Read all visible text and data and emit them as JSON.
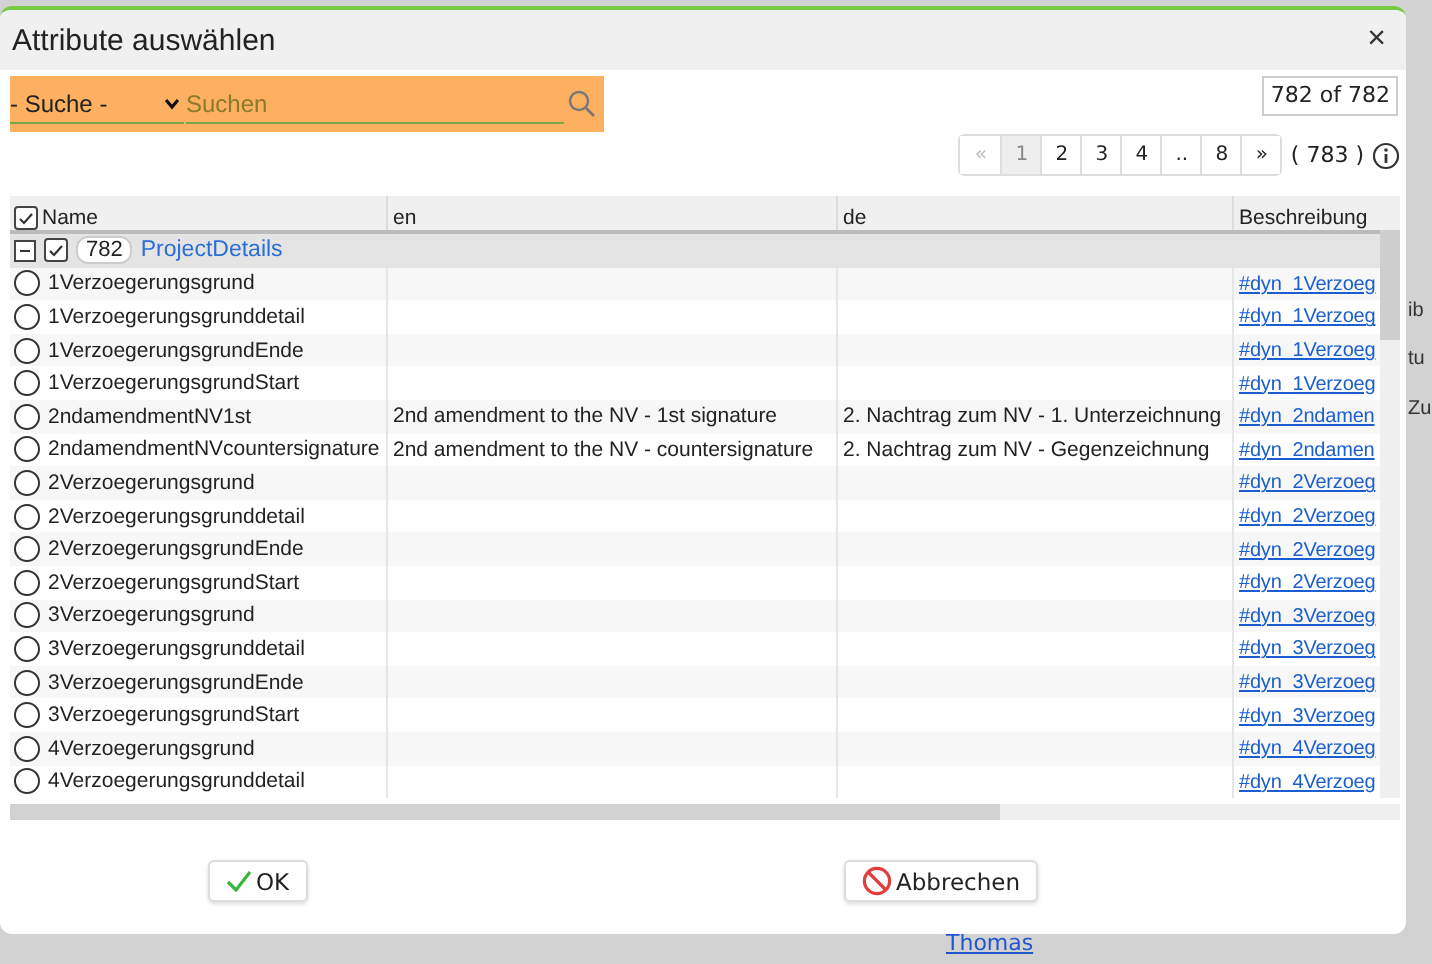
{
  "dialog": {
    "title": "Attribute auswählen",
    "close": "×"
  },
  "search": {
    "scope": "- Suche -",
    "placeholder": "Suchen"
  },
  "count": "782 of 782",
  "pagination": {
    "pages": [
      {
        "label": "«",
        "disabled": true,
        "selected": false
      },
      {
        "label": "1",
        "disabled": false,
        "selected": true
      },
      {
        "label": "2",
        "disabled": false,
        "selected": false
      },
      {
        "label": "3",
        "disabled": false,
        "selected": false
      },
      {
        "label": "4",
        "disabled": false,
        "selected": false
      },
      {
        "label": "..",
        "disabled": false,
        "selected": false
      },
      {
        "label": "8",
        "disabled": false,
        "selected": false
      },
      {
        "label": "»",
        "disabled": false,
        "selected": false
      }
    ],
    "total": "( 783 )"
  },
  "table": {
    "columns": [
      "Name",
      "en",
      "de",
      "Beschreibung"
    ],
    "all_checked": true,
    "group": {
      "expanded": true,
      "checked": true,
      "count": "782",
      "name": "ProjectDetails"
    },
    "rows": [
      {
        "name": "1Verzoegerungsgrund",
        "en": "",
        "de": "",
        "desc": "#dyn_1Verzoeg",
        "selected": false
      },
      {
        "name": "1Verzoegerungsgrunddetail",
        "en": "",
        "de": "",
        "desc": "#dyn_1Verzoeg",
        "selected": false
      },
      {
        "name": "1VerzoegerungsgrundEnde",
        "en": "",
        "de": "",
        "desc": "#dyn_1Verzoeg",
        "selected": false
      },
      {
        "name": "1VerzoegerungsgrundStart",
        "en": "",
        "de": "",
        "desc": "#dyn_1Verzoeg",
        "selected": false
      },
      {
        "name": "2ndamendmentNV1st",
        "en": "2nd amendment to the NV - 1st signature",
        "de": "2. Nachtrag zum NV - 1. Unterzeichnung",
        "desc": "#dyn_2ndamen",
        "selected": false
      },
      {
        "name": "2ndamendmentNVcountersignature",
        "en": "2nd amendment to the NV - countersignature",
        "de": "2. Nachtrag zum NV - Gegenzeichnung",
        "desc": "#dyn_2ndamen",
        "selected": false
      },
      {
        "name": "2Verzoegerungsgrund",
        "en": "",
        "de": "",
        "desc": "#dyn_2Verzoeg",
        "selected": false
      },
      {
        "name": "2Verzoegerungsgrunddetail",
        "en": "",
        "de": "",
        "desc": "#dyn_2Verzoeg",
        "selected": false
      },
      {
        "name": "2VerzoegerungsgrundEnde",
        "en": "",
        "de": "",
        "desc": "#dyn_2Verzoeg",
        "selected": false
      },
      {
        "name": "2VerzoegerungsgrundStart",
        "en": "",
        "de": "",
        "desc": "#dyn_2Verzoeg",
        "selected": false
      },
      {
        "name": "3Verzoegerungsgrund",
        "en": "",
        "de": "",
        "desc": "#dyn_3Verzoeg",
        "selected": false
      },
      {
        "name": "3Verzoegerungsgrunddetail",
        "en": "",
        "de": "",
        "desc": "#dyn_3Verzoeg",
        "selected": false
      },
      {
        "name": "3VerzoegerungsgrundEnde",
        "en": "",
        "de": "",
        "desc": "#dyn_3Verzoeg",
        "selected": false
      },
      {
        "name": "3VerzoegerungsgrundStart",
        "en": "",
        "de": "",
        "desc": "#dyn_3Verzoeg",
        "selected": false
      },
      {
        "name": "4Verzoegerungsgrund",
        "en": "",
        "de": "",
        "desc": "#dyn_4Verzoeg",
        "selected": false
      },
      {
        "name": "4Verzoegerungsgrunddetail",
        "en": "",
        "de": "",
        "desc": "#dyn_4Verzoeg",
        "selected": false
      }
    ]
  },
  "buttons": [
    {
      "label": "OK",
      "kind": "ok"
    },
    {
      "label": "Abbrechen",
      "kind": "cancel"
    }
  ],
  "background": {
    "texts": [
      "ib",
      "tu",
      "Zu"
    ],
    "link": "Thomas"
  }
}
